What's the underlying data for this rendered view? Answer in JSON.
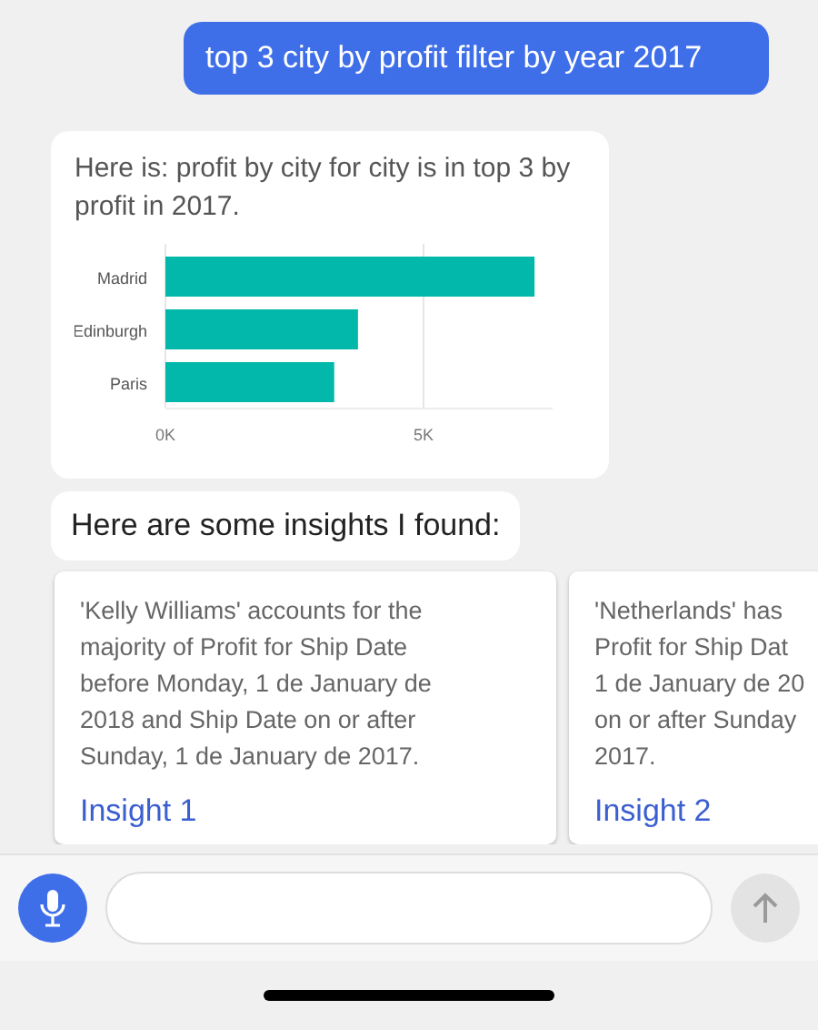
{
  "messages": [
    {
      "kind": "user",
      "text": "top 3 city by profit filter by year 2017"
    },
    {
      "kind": "chart",
      "text": "Here is: profit by city for city is in top 3 by profit in 2017.",
      "chart_data": {
        "type": "bar",
        "orientation": "horizontal",
        "categories": [
          "Madrid",
          "Edinburgh",
          "Paris"
        ],
        "series": [
          {
            "color": "#01b8aa",
            "values": [
              7150,
              3730,
              3270
            ]
          }
        ],
        "xlim": [
          0,
          7500
        ],
        "xticks": [
          {
            "value": 0,
            "label": "0K"
          },
          {
            "value": 5000,
            "label": "5K"
          }
        ]
      }
    },
    {
      "kind": "bot",
      "text": "Here are some insights I found:"
    }
  ],
  "insights": [
    {
      "lines": [
        "'Kelly Williams' accounts for the",
        "majority of Profit for Ship Date",
        "before Monday, 1 de January de",
        "2018 and Ship Date on or after",
        "Sunday, 1 de January de 2017."
      ],
      "link": "Insight 1"
    },
    {
      "lines": [
        "'Netherlands' has",
        "Profit for Ship Dat",
        "1 de January de 20",
        "on or after Sunday",
        "2017."
      ],
      "link": "Insight 2"
    }
  ],
  "composer": {
    "mic": true
  }
}
